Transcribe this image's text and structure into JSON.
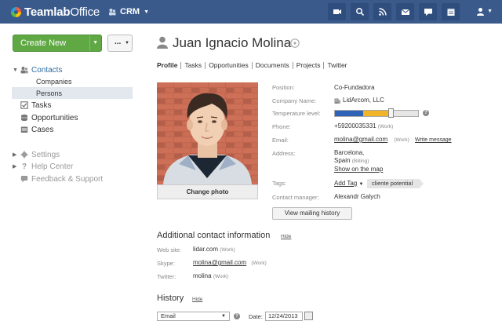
{
  "topbar": {
    "logo_bold": "Teamlab",
    "logo_light": "Office",
    "module": "CRM",
    "icons": [
      "video-icon",
      "search-icon",
      "feed-icon",
      "mail-icon",
      "chat-icon",
      "calendar-icon"
    ]
  },
  "sidebar": {
    "create_label": "Create New",
    "more_label": "...",
    "contacts_label": "Contacts",
    "companies_label": "Companies",
    "persons_label": "Persons",
    "tasks_label": "Tasks",
    "opportunities_label": "Opportunities",
    "cases_label": "Cases",
    "settings_label": "Settings",
    "help_label": "Help Center",
    "feedback_label": "Feedback & Support"
  },
  "person": {
    "name": "Juan Ignacio Molina",
    "tabs": [
      "Profile",
      "Tasks",
      "Opportunities",
      "Documents",
      "Projects",
      "Twitter"
    ],
    "change_photo": "Change photo",
    "position_label": "Position:",
    "position": "Co-Fundadora",
    "company_label": "Company Name:",
    "company": "LidArcom, LLC",
    "temperature_label": "Temperature level:",
    "temperature_colors": [
      "#2e63b8",
      "#f0b429",
      "#e6e6e6"
    ],
    "phone_label": "Phone:",
    "phone": "+59200035331",
    "phone_type": "(Work)",
    "email_label": "Email:",
    "email": "molina@gmail.com",
    "email_type": "(Work)",
    "write_message": "Write message",
    "address_label": "Address:",
    "address_city": "Barcelona,",
    "address_country": "Spain",
    "address_type": "(Billing)",
    "show_map": "Show on the map",
    "tags_label": "Tags:",
    "add_tag": "Add Tag",
    "tag": "cliente potential",
    "manager_label": "Contact manager:",
    "manager": "Alexandr Galych",
    "mailing_history": "View mailing history"
  },
  "additional": {
    "title": "Additional contact information",
    "hide": "Hide",
    "website_label": "Web site:",
    "website": "lidar.com",
    "website_type": "(Work)",
    "skype_label": "Skype:",
    "skype": "molina@gmail.com",
    "skype_type": "(Work)",
    "twitter_label": "Twitter:",
    "twitter": "molina",
    "twitter_type": "(Work)"
  },
  "history": {
    "title": "History",
    "hide": "Hide",
    "type_select": "Email",
    "date_label": "Date:",
    "date": "12/24/2013"
  }
}
